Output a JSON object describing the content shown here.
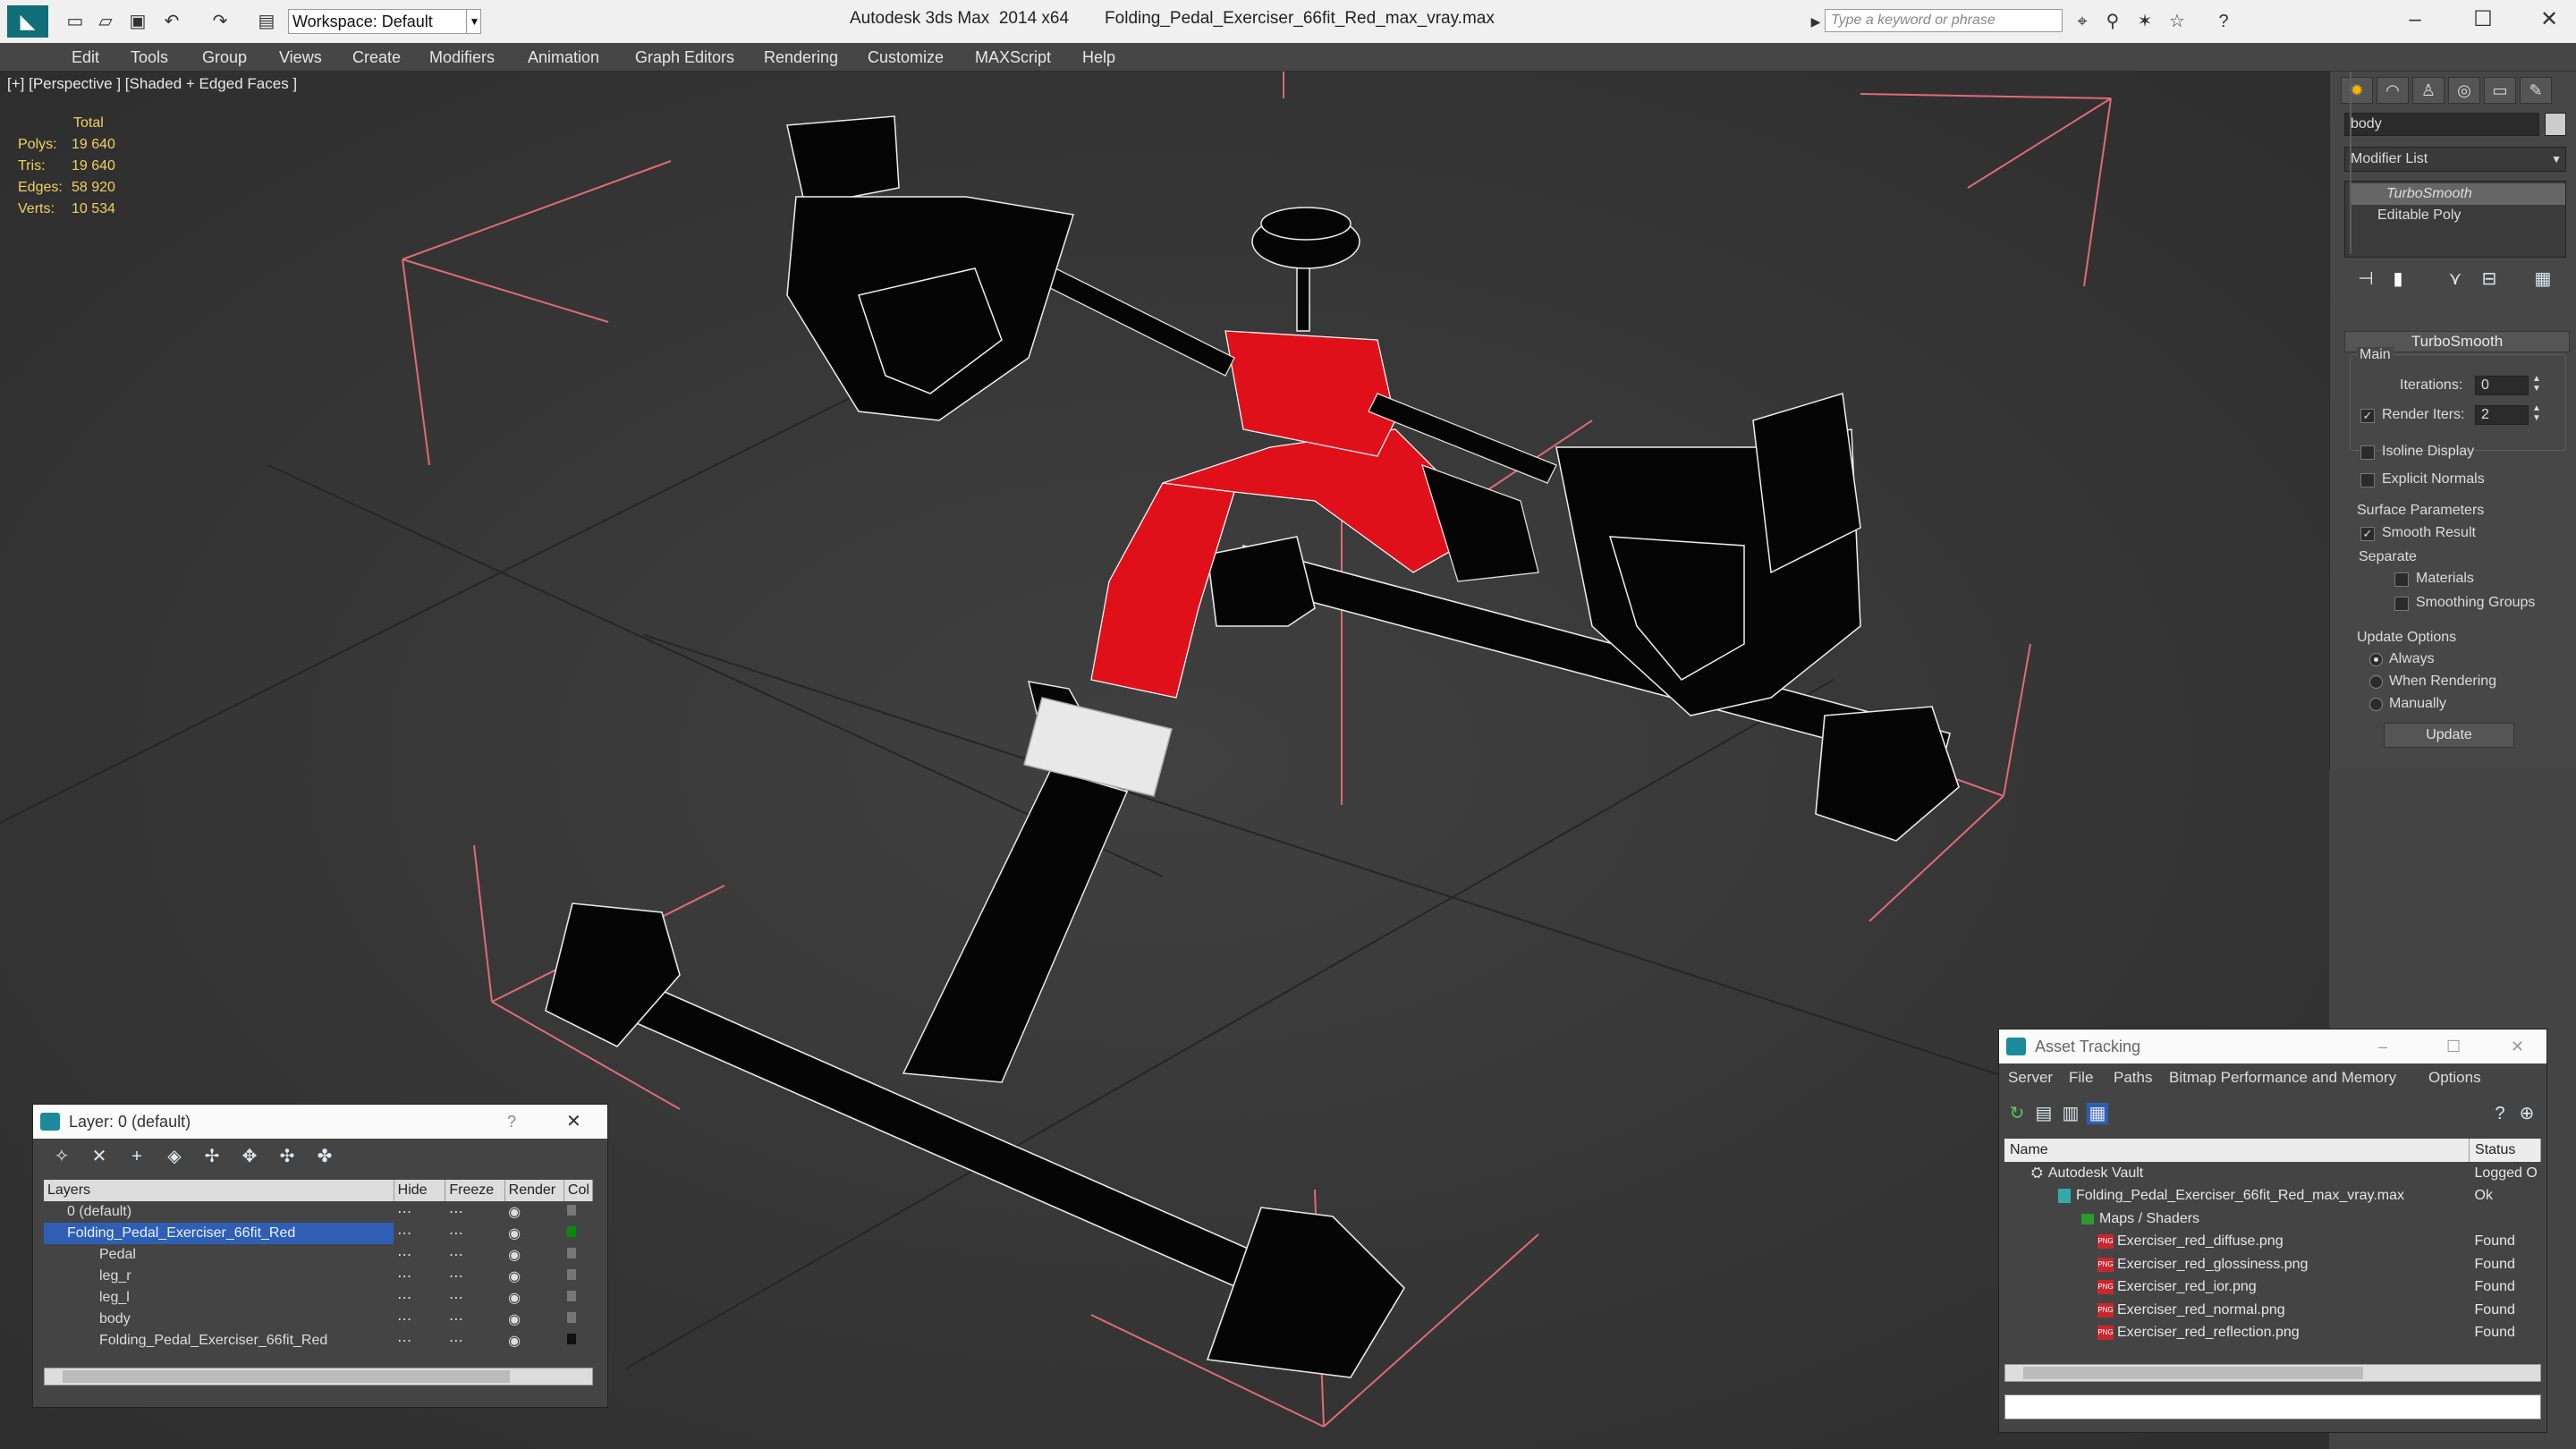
{
  "app": {
    "title": "Autodesk 3ds Max  2014 x64",
    "file": "Folding_Pedal_Exerciser_66fit_Red_max_vray.max",
    "workspace": "Workspace: Default",
    "search_placeholder": "Type a keyword or phrase"
  },
  "menu": [
    "Edit",
    "Tools",
    "Group",
    "Views",
    "Create",
    "Modifiers",
    "Animation",
    "Graph Editors",
    "Rendering",
    "Customize",
    "MAXScript",
    "Help"
  ],
  "viewport": {
    "label": "[+] [Perspective ] [Shaded + Edged Faces ]",
    "stats": {
      "header": "Total",
      "rows": [
        {
          "k": "Polys:",
          "v": "19 640"
        },
        {
          "k": "Tris:",
          "v": "19 640"
        },
        {
          "k": "Edges:",
          "v": "58 920"
        },
        {
          "k": "Verts:",
          "v": "10 534"
        }
      ]
    }
  },
  "command_panel": {
    "object_name": "body",
    "modifier_list": "Modifier List",
    "stack": [
      "TurboSmooth",
      "Editable Poly"
    ],
    "rollout": "TurboSmooth",
    "main": "Main",
    "iterations_label": "Iterations:",
    "iterations": "0",
    "render_iters_label": "Render Iters:",
    "render_iters": "2",
    "isoline": "Isoline Display",
    "explicit_normals": "Explicit Normals",
    "surface_params": "Surface Parameters",
    "smooth_result": "Smooth Result",
    "separate": "Separate",
    "materials": "Materials",
    "smoothing_groups": "Smoothing Groups",
    "update_options": "Update Options",
    "always": "Always",
    "when_rendering": "When Rendering",
    "manually": "Manually",
    "update_btn": "Update"
  },
  "layer_window": {
    "title": "Layer: 0 (default)",
    "help": "?",
    "headers": [
      "Layers",
      "Hide",
      "Freeze",
      "Render",
      "Col"
    ],
    "rows": [
      {
        "name": "0 (default)",
        "indent": 0
      },
      {
        "name": "Folding_Pedal_Exerciser_66fit_Red",
        "indent": 0,
        "selected": true
      },
      {
        "name": "Pedal",
        "indent": 1
      },
      {
        "name": "leg_r",
        "indent": 1
      },
      {
        "name": "leg_l",
        "indent": 1
      },
      {
        "name": "body",
        "indent": 1
      },
      {
        "name": "Folding_Pedal_Exerciser_66fit_Red",
        "indent": 1
      }
    ],
    "colors": {
      "accent": "#2f5fb5",
      "red": "#e0101b"
    }
  },
  "asset_window": {
    "title": "Asset Tracking",
    "menu": [
      "Server",
      "File",
      "Paths",
      "Bitmap Performance and Memory",
      "Options"
    ],
    "headers": [
      "Name",
      "Status"
    ],
    "rows": [
      {
        "name": "Autodesk Vault",
        "status": "Logged O",
        "indent": 0,
        "icon": "vault"
      },
      {
        "name": "Folding_Pedal_Exerciser_66fit_Red_max_vray.max",
        "status": "Ok",
        "indent": 1,
        "icon": "max"
      },
      {
        "name": "Maps / Shaders",
        "status": "",
        "indent": 2,
        "icon": "folder"
      },
      {
        "name": "Exerciser_red_diffuse.png",
        "status": "Found",
        "indent": 3,
        "icon": "png"
      },
      {
        "name": "Exerciser_red_glossiness.png",
        "status": "Found",
        "indent": 3,
        "icon": "png"
      },
      {
        "name": "Exerciser_red_ior.png",
        "status": "Found",
        "indent": 3,
        "icon": "png"
      },
      {
        "name": "Exerciser_red_normal.png",
        "status": "Found",
        "indent": 3,
        "icon": "png"
      },
      {
        "name": "Exerciser_red_reflection.png",
        "status": "Found",
        "indent": 3,
        "icon": "png"
      }
    ]
  }
}
